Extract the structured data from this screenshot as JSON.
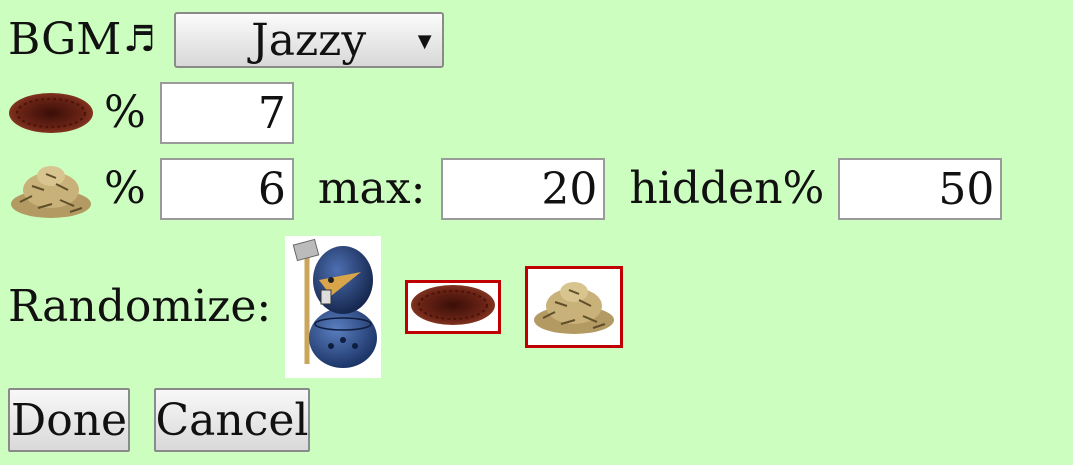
{
  "bgm": {
    "label": "BGM",
    "note_glyph": "♬",
    "selected": "Jazzy"
  },
  "pit": {
    "icon": "pit-icon",
    "percent_label": "%",
    "percent_value": "7"
  },
  "gold": {
    "icon": "gold-pile-icon",
    "percent_label": "%",
    "percent_value": "6",
    "max_label": "max:",
    "max_value": "20",
    "hidden_label": "hidden%",
    "hidden_value": "50"
  },
  "randomize": {
    "label": "Randomize:",
    "options": [
      "wumpus-character-icon",
      "pit-icon",
      "gold-pile-icon"
    ]
  },
  "buttons": {
    "done": "Done",
    "cancel": "Cancel"
  },
  "colors": {
    "background": "#ccffbf",
    "selected_border": "#c00000"
  }
}
